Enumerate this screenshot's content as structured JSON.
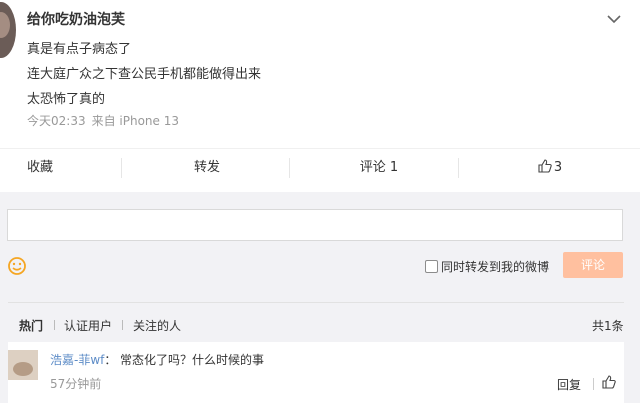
{
  "post": {
    "username": "给你吃奶油泡芙",
    "lines": [
      "真是有点子病态了",
      "连大庭广众之下查公民手机都能做得出来",
      "太恐怖了真的"
    ],
    "time": "今天02:33",
    "source": "来自 iPhone 13"
  },
  "actions": {
    "collect": "收藏",
    "forward": "转发",
    "comment": "评论 1",
    "like_count": "3"
  },
  "composer": {
    "checkbox_label": "同时转发到我的微博",
    "submit_label": "评论"
  },
  "comments_tabs": {
    "hot": "热门",
    "verified": "认证用户",
    "following": "关注的人",
    "total": "共1条"
  },
  "comments": [
    {
      "name": "浩嘉-菲wf",
      "separator": "：",
      "text": "常态化了吗？什么时候的事",
      "time": "57分钟前",
      "reply": "回复"
    }
  ],
  "colors": {
    "link": "#5d8cc7",
    "submit_bg": "#ffc09f",
    "emoji": "#f5a623"
  }
}
